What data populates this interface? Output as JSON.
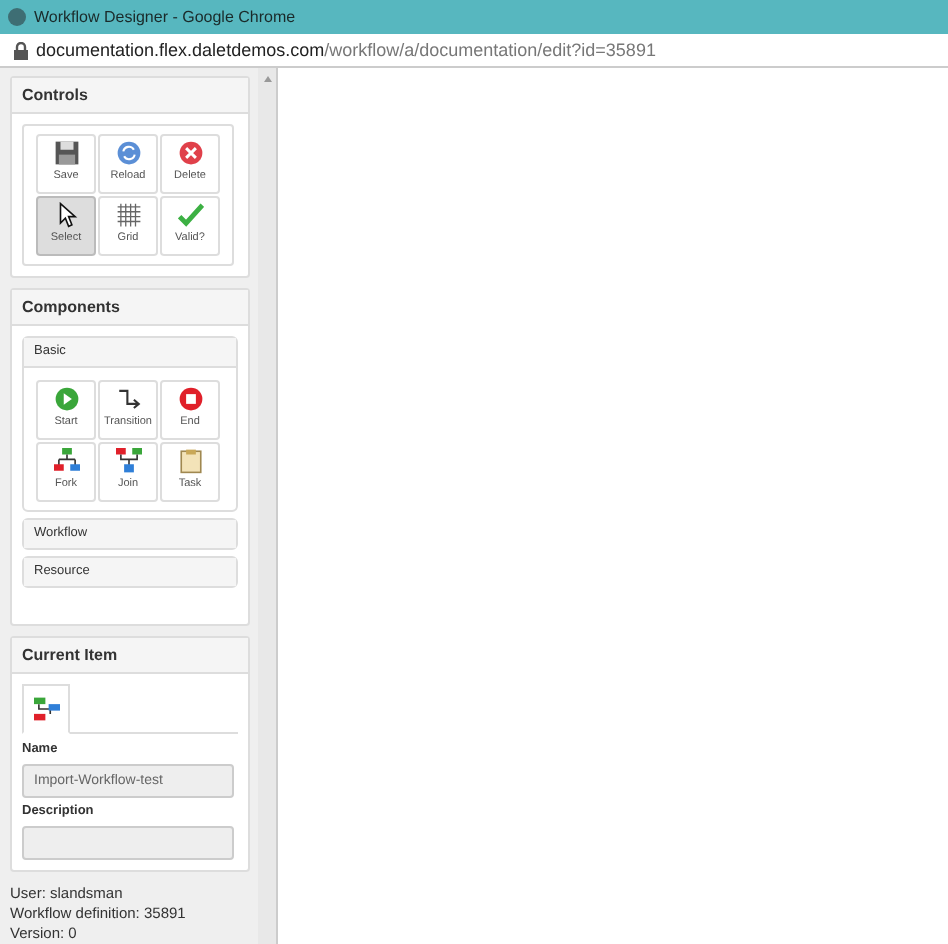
{
  "window": {
    "title": "Workflow Designer - Google Chrome"
  },
  "address_bar": {
    "host": "documentation.flex.daletdemos.com",
    "path": "/workflow/a/documentation/edit?id=35891"
  },
  "controls": {
    "title": "Controls",
    "tools": [
      {
        "kind": "save",
        "label": "Save",
        "selected": false
      },
      {
        "kind": "reload",
        "label": "Reload",
        "selected": false
      },
      {
        "kind": "delete",
        "label": "Delete",
        "selected": false
      },
      {
        "kind": "select",
        "label": "Select",
        "selected": true
      },
      {
        "kind": "grid",
        "label": "Grid",
        "selected": false
      },
      {
        "kind": "valid",
        "label": "Valid?",
        "selected": false
      }
    ]
  },
  "components": {
    "title": "Components",
    "groups": [
      {
        "label": "Basic",
        "expanded": true,
        "tools": [
          {
            "kind": "start",
            "label": "Start"
          },
          {
            "kind": "transition",
            "label": "Transition"
          },
          {
            "kind": "end",
            "label": "End"
          },
          {
            "kind": "fork",
            "label": "Fork"
          },
          {
            "kind": "join",
            "label": "Join"
          },
          {
            "kind": "task",
            "label": "Task"
          }
        ]
      },
      {
        "label": "Workflow",
        "expanded": false
      },
      {
        "label": "Resource",
        "expanded": false
      }
    ]
  },
  "current_item": {
    "title": "Current Item",
    "fields": [
      {
        "label": "Name",
        "value": "Import-Workflow-test"
      },
      {
        "label": "Description"
      }
    ]
  },
  "footer": [
    "User: slandsman",
    "Workflow definition: 35891",
    "Version: 0"
  ]
}
